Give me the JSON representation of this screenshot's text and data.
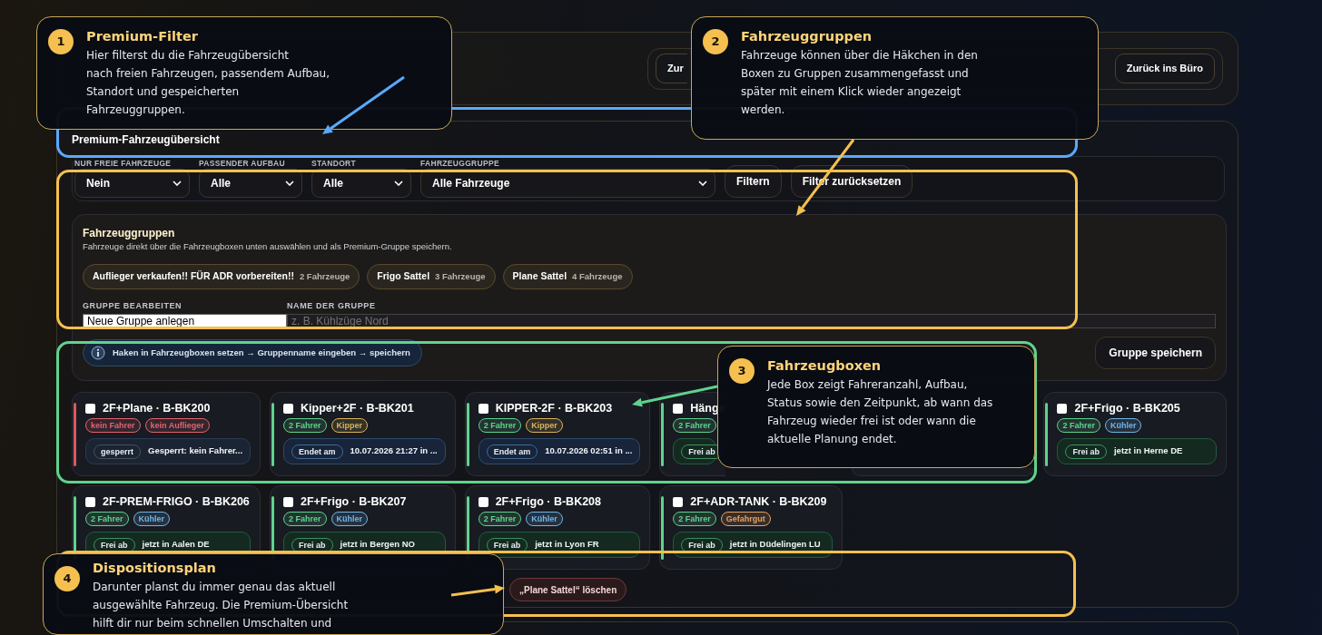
{
  "header": {
    "nav_buttons": [
      {
        "label": "Zur",
        "kind": "ghost"
      },
      {
        "label": "Zurück ins Büro",
        "kind": "solid"
      }
    ]
  },
  "overview": {
    "title": "Premium-Fahrzeugübersicht",
    "filters": [
      {
        "label": "NUR FREIE FAHRZEUGE",
        "value": "Nein"
      },
      {
        "label": "PASSENDER AUFBAU",
        "value": "Alle"
      },
      {
        "label": "STANDORT",
        "value": "Alle"
      },
      {
        "label": "FAHRZEUGGRUPPE",
        "value": "Alle Fahrzeuge"
      }
    ],
    "filter_buttons": [
      "Filtern",
      "Filter zurücksetzen"
    ],
    "groups": {
      "title": "Fahrzeuggruppen",
      "description": "Fahrzeuge direkt über die Fahrzeugboxen unten auswählen und als Premium-Gruppe speichern.",
      "chips": [
        {
          "name": "Auflieger verkaufen!! FÜR ADR vorbereiten!!",
          "count": "2 Fahrzeuge"
        },
        {
          "name": "Frigo Sattel",
          "count": "3 Fahrzeuge"
        },
        {
          "name": "Plane Sattel",
          "count": "4 Fahrzeuge"
        }
      ],
      "edit_label": "GRUPPE BEARBEITEN",
      "edit_value": "Neue Gruppe anlegen",
      "name_label": "NAME DER GRUPPE",
      "name_placeholder": "z. B. Kühlzüge Nord",
      "hint": "Haken in Fahrzeugboxen setzen → Gruppenname eingeben → speichern",
      "save_button": "Gruppe speichern"
    },
    "vehicles": [
      {
        "title": "2F+Plane · B-BK200",
        "checked": false,
        "color": "#e0555f",
        "tags": [
          {
            "text": "kein Fahrer",
            "color": "#e0656f"
          },
          {
            "text": "kein Auflieger",
            "color": "#e0656f"
          }
        ],
        "status": {
          "kind": "blocked",
          "label": "gesperrt",
          "text": "Gesperrt: kein Fahrer..."
        }
      },
      {
        "title": "Kipper+2F · B-BK201",
        "checked": false,
        "color": "#5fd38d",
        "tags": [
          {
            "text": "2 Fahrer",
            "color": "#5fd38d"
          },
          {
            "text": "Kipper",
            "color": "#d9b45a"
          }
        ],
        "status": {
          "kind": "ends",
          "label": "Endet am",
          "text": "10.07.2026 21:27 in ..."
        }
      },
      {
        "title": "KIPPER-2F · B-BK203",
        "checked": false,
        "color": "#5fd38d",
        "tags": [
          {
            "text": "2 Fahrer",
            "color": "#5fd38d"
          },
          {
            "text": "Kipper",
            "color": "#d9b45a"
          }
        ],
        "status": {
          "kind": "ends",
          "label": "Endet am",
          "text": "10.07.2026 02:51 in ..."
        }
      },
      {
        "title": "Hänge",
        "checked": false,
        "color": "#5fd38d",
        "tags": [
          {
            "text": "2 Fahrer",
            "color": "#5fd38d"
          }
        ],
        "status": {
          "kind": "free",
          "label": "Frei ab"
        }
      },
      {
        "covered": true
      },
      {
        "title": "2F+Frigo · B-BK205",
        "checked": false,
        "color": "#5fd38d",
        "tags": [
          {
            "text": "2 Fahrer",
            "color": "#5fd38d"
          },
          {
            "text": "Kühler",
            "color": "#6fb6e8"
          }
        ],
        "status": {
          "kind": "free",
          "label": "Frei ab",
          "text": "jetzt in Herne DE"
        }
      },
      {
        "title": "2F-PREM-FRIGO · B-BK206",
        "checked": false,
        "color": "#5fd38d",
        "tags": [
          {
            "text": "2 Fahrer",
            "color": "#5fd38d"
          },
          {
            "text": "Kühler",
            "color": "#6fb6e8"
          }
        ],
        "status": {
          "kind": "free",
          "label": "Frei ab",
          "text": "jetzt in Aalen DE"
        }
      },
      {
        "title": "2F+Frigo · B-BK207",
        "checked": false,
        "color": "#5fd38d",
        "tags": [
          {
            "text": "2 Fahrer",
            "color": "#5fd38d"
          },
          {
            "text": "Kühler",
            "color": "#6fb6e8"
          }
        ],
        "status": {
          "kind": "free",
          "label": "Frei ab",
          "text": "jetzt in Bergen NO"
        }
      },
      {
        "title": "2F+Frigo · B-BK208",
        "checked": false,
        "color": "#5fd38d",
        "tags": [
          {
            "text": "2 Fahrer",
            "color": "#5fd38d"
          },
          {
            "text": "Kühler",
            "color": "#6fb6e8"
          }
        ],
        "status": {
          "kind": "free",
          "label": "Frei ab",
          "text": "jetzt in Lyon FR"
        }
      },
      {
        "title": "2F+ADR-TANK · B-BK209",
        "checked": false,
        "color": "#5fd38d",
        "tags": [
          {
            "text": "2 Fahrer",
            "color": "#5fd38d"
          },
          {
            "text": "Gefahrgut",
            "color": "#e8a060"
          }
        ],
        "status": {
          "kind": "free",
          "label": "Frei ab",
          "text": "jetzt in Düdelingen LU"
        }
      }
    ],
    "delete_buttons": [
      "„Plane Sattel“ löschen"
    ]
  },
  "frames": [
    {
      "color": "#5aa9ff"
    },
    {
      "color": "#f5c04f"
    },
    {
      "color": "#5fd38d"
    },
    {
      "color": "#f5c04f"
    }
  ],
  "callouts": [
    {
      "number": "1",
      "title": "Premium-Filter",
      "lines": [
        "Hier filterst du die Fahrzeugübersicht",
        "nach freien Fahrzeugen, passendem Aufbau,",
        "Standort und gespeicherten",
        "Fahrzeuggruppen."
      ]
    },
    {
      "number": "2",
      "title": "Fahrzeuggruppen",
      "lines": [
        "Fahrzeuge können über die Häkchen in den",
        "Boxen zu Gruppen zusammengefasst und",
        "später mit einem Klick wieder angezeigt",
        "werden."
      ]
    },
    {
      "number": "3",
      "title": "Fahrzeugboxen",
      "lines": [
        "Jede Box zeigt Fahreranzahl, Aufbau,",
        "Status sowie den Zeitpunkt, ab wann das",
        "Fahrzeug wieder frei ist oder wann die",
        "aktuelle Planung endet."
      ]
    },
    {
      "number": "4",
      "title": "Dispositionsplan",
      "lines": [
        "Darunter planst du immer genau das aktuell",
        "ausgewählte Fahrzeug. Die Premium-Übersicht",
        "hilft dir nur beim schnellen Umschalten und"
      ]
    }
  ]
}
